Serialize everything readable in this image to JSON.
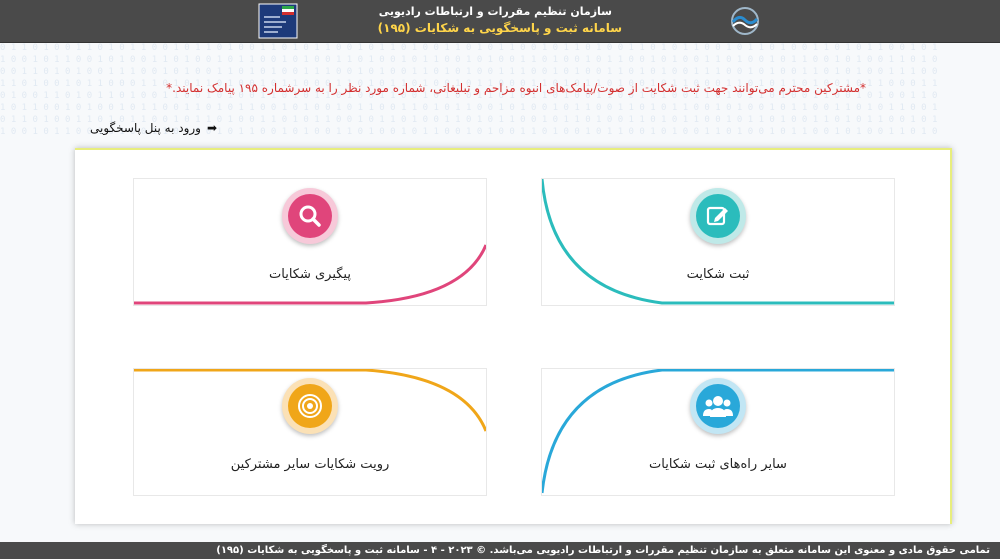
{
  "header": {
    "org_name": "سازمان تنظیم مقررات و ارتباطات رادیویی",
    "system_name": "سامانه ثبت و پاسخگویی به شکایات (۱۹۵)"
  },
  "notice": "*مشترکین محترم می‌توانند جهت ثبت شکایت از صوت/پیامک‌های انبوه مزاحم و تبلیغاتی، شماره مورد نظر را به سرشماره ۱۹۵ پیامک نمایند.*",
  "panel_link": "ورود به پنل پاسخگویی",
  "tiles": [
    {
      "label": "ثبت شکایت",
      "icon": "edit-icon",
      "color": "#2bbcbc"
    },
    {
      "label": "پیگیری شکایات",
      "icon": "search-icon",
      "color": "#e0457b"
    },
    {
      "label": "سایر راه‌های ثبت شکایات",
      "icon": "users-icon",
      "color": "#29a8d9"
    },
    {
      "label": "رویت شکایات سایر مشترکین",
      "icon": "target-icon",
      "color": "#f0a619"
    }
  ],
  "footer": "تمامی حقوق مادی و معنوی این سامانه متعلق به سازمان تنظیم مقررات و ارتباطات رادیویی می‌باشد. © ۲۰۲۳ - ۴ - سامانه ثبت و پاسخگویی به شکایات (۱۹۵)"
}
